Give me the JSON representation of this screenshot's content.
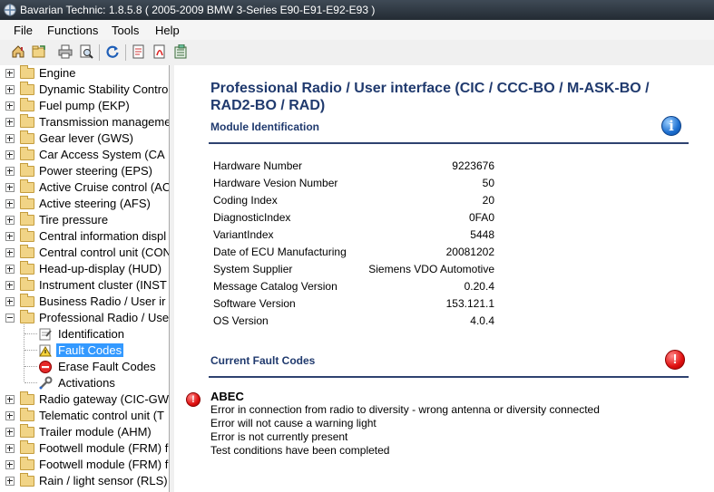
{
  "window": {
    "title": "Bavarian Technic: 1.8.5.8  ( 2005-2009 BMW 3-Series E90-E91-E92-E93 )"
  },
  "menu": [
    "File",
    "Functions",
    "Tools",
    "Help"
  ],
  "toolbar": [
    "home-icon",
    "open-folder-icon",
    "print-icon",
    "print-preview-icon",
    "refresh-icon",
    "report-icon",
    "pdf-icon",
    "export-icon"
  ],
  "tree": {
    "nodes_top": [
      "Engine",
      "Dynamic Stability Contro",
      "Fuel pump (EKP)",
      "Transmission manageme",
      "Gear lever (GWS)",
      "Car Access System (CA",
      "Power steering (EPS)",
      "Active Cruise control (AC",
      "Active steering (AFS)",
      "Tire pressure",
      "Central information displ",
      "Central control unit (CON",
      "Head-up-display (HUD)",
      "Instrument cluster (INST",
      "Business Radio / User ir",
      "Professional Radio / Use"
    ],
    "children": [
      {
        "label": "Identification",
        "icon": "identification-icon"
      },
      {
        "label": "Fault Codes",
        "icon": "fault-codes-icon"
      },
      {
        "label": "Erase Fault Codes",
        "icon": "erase-icon"
      },
      {
        "label": "Activations",
        "icon": "wrench-icon"
      }
    ],
    "nodes_bottom": [
      "Radio gateway (CIC-GW",
      "Telematic control unit (T",
      "Trailer module (AHM)",
      "Footwell module (FRM) f",
      "Footwell module (FRM) f",
      "Rain / light sensor (RLS)"
    ]
  },
  "content": {
    "title": "Professional Radio / User interface (CIC / CCC-BO / M-ASK-BO / RAD2-BO / RAD)",
    "module_id_heading": "Module Identification",
    "rows": [
      {
        "label": "Hardware Number",
        "value": "9223676"
      },
      {
        "label": "Hardware Vesion Number",
        "value": "50"
      },
      {
        "label": "Coding Index",
        "value": "20"
      },
      {
        "label": "DiagnosticIndex",
        "value": "0FA0"
      },
      {
        "label": "VariantIndex",
        "value": "5448"
      },
      {
        "label": "Date of ECU Manufacturing",
        "value": "20081202"
      },
      {
        "label": "System Supplier",
        "value": "Siemens VDO Automotive"
      },
      {
        "label": "Message Catalog Version",
        "value": "0.20.4"
      },
      {
        "label": "Software Version",
        "value": "153.121.1"
      },
      {
        "label": "OS Version",
        "value": "4.0.4"
      }
    ],
    "fault_heading": "Current Fault Codes",
    "fault": {
      "code": "ABEC",
      "lines": [
        "Error in connection from radio to diversity - wrong antenna or diversity connected",
        "Error will not cause a warning light",
        "Error is not currently present",
        "Test conditions have been completed"
      ]
    }
  },
  "colors": {
    "heading": "#203a6e",
    "selection": "#3399ff",
    "titlebar": "#2b333c"
  }
}
